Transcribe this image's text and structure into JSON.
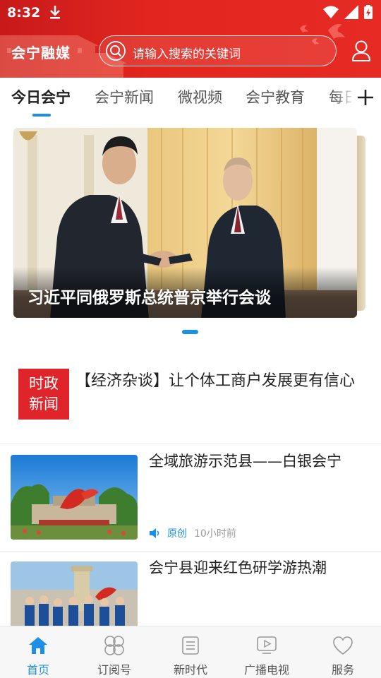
{
  "status_bar": {
    "time": "8:32"
  },
  "header": {
    "logo": "会宁融媒",
    "search_placeholder": "请输入搜索的关键词"
  },
  "tabs": [
    {
      "label": "今日会宁",
      "active": true
    },
    {
      "label": "会宁新闻",
      "active": false
    },
    {
      "label": "微视频",
      "active": false
    },
    {
      "label": "会宁教育",
      "active": false
    },
    {
      "label": "每日",
      "active": false
    }
  ],
  "carousel": {
    "caption": "习近平同俄罗斯总统普京举行会谈"
  },
  "politics": {
    "badge_line1": "时政",
    "badge_line2": "新闻",
    "headline": "【经济杂谈】让个体工商户发展更有信心"
  },
  "news": [
    {
      "title": "全域旅游示范县——白银会宁",
      "tag": "原创",
      "time": "10小时前"
    },
    {
      "title": "会宁县迎来红色研学游热潮"
    }
  ],
  "bottom_nav": [
    {
      "label": "首页",
      "icon": "home-icon",
      "active": true
    },
    {
      "label": "订阅号",
      "icon": "clover-icon",
      "active": false
    },
    {
      "label": "新时代",
      "icon": "document-icon",
      "active": false
    },
    {
      "label": "广播电视",
      "icon": "tv-play-icon",
      "active": false
    },
    {
      "label": "服务",
      "icon": "heart-icon",
      "active": false
    }
  ],
  "colors": {
    "brand_red": "#e2261f",
    "accent_blue": "#1e8fe6",
    "badge_red": "#e0252a"
  }
}
